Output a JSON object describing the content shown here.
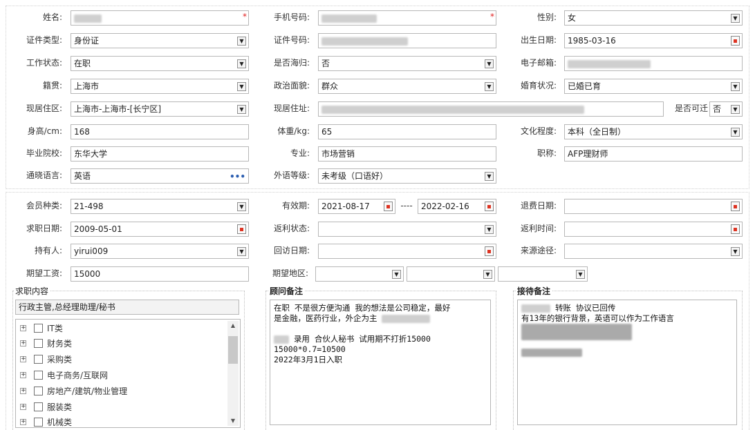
{
  "profile": {
    "name": {
      "label": "姓名:"
    },
    "mobile": {
      "label": "手机号码:"
    },
    "gender": {
      "label": "性别:",
      "value": "女"
    },
    "id_type": {
      "label": "证件类型:",
      "value": "身份证"
    },
    "id_number": {
      "label": "证件号码:"
    },
    "birth_date": {
      "label": "出生日期:",
      "value": "1985-03-16"
    },
    "work_status": {
      "label": "工作状态:",
      "value": "在职"
    },
    "returnee": {
      "label": "是否海归:",
      "value": "否"
    },
    "email": {
      "label": "电子邮箱:"
    },
    "native_place": {
      "label": "籍贯:",
      "value": "上海市"
    },
    "political": {
      "label": "政治面貌:",
      "value": "群众"
    },
    "marital": {
      "label": "婚育状况:",
      "value": "已婚已育"
    },
    "current_city": {
      "label": "现居住区:",
      "value": "上海市-上海市-[长宁区]"
    },
    "current_address": {
      "label": "现居住址:"
    },
    "relocate": {
      "label": "是否可迁",
      "value": "否"
    },
    "height": {
      "label": "身高/cm:",
      "value": "168"
    },
    "weight": {
      "label": "体重/kg:",
      "value": "65"
    },
    "education": {
      "label": "文化程度:",
      "value": "本科（全日制）"
    },
    "school": {
      "label": "毕业院校:",
      "value": "东华大学"
    },
    "major": {
      "label": "专业:",
      "value": "市场营销"
    },
    "title": {
      "label": "职称:",
      "value": "AFP理财师"
    },
    "language": {
      "label": "通晓语言:",
      "value": "英语"
    },
    "language_level": {
      "label": "外语等级:",
      "value": "未考级（口语好）"
    }
  },
  "membership": {
    "member_type": {
      "label": "会员种类:",
      "value": "21-498"
    },
    "validity": {
      "label": "有效期:",
      "start": "2021-08-17",
      "sep": "----",
      "end": "2022-02-16"
    },
    "refund_date": {
      "label": "退费日期:",
      "value": ""
    },
    "job_date": {
      "label": "求职日期:",
      "value": "2009-05-01"
    },
    "rebate_status": {
      "label": "返利状态:",
      "value": ""
    },
    "rebate_time": {
      "label": "返利时间:",
      "value": ""
    },
    "holder": {
      "label": "持有人:",
      "value": "yirui009"
    },
    "revisit_date": {
      "label": "回访日期:",
      "value": ""
    },
    "source": {
      "label": "来源途径:",
      "value": ""
    },
    "expected_salary": {
      "label": "期望工资:",
      "value": "15000"
    },
    "expected_area": {
      "label": "期望地区:"
    }
  },
  "job_content": {
    "legend": "求职内容",
    "selected": "行政主管,总经理助理/秘书",
    "tree": [
      "IT类",
      "财务类",
      "采购类",
      "电子商务/互联网",
      "房地产/建筑/物业管理",
      "服装类",
      "机械类"
    ]
  },
  "consultant_notes": {
    "legend": "顾问备注",
    "line1": "在职 不是很方便沟通 我的想法是公司稳定，最好",
    "line2": "是金融，医药行业，外企为主",
    "line3": "录用 合伙人秘书 试用期不打折15000",
    "line4": "15000*0.7=10500",
    "line5": "2022年3月1日入职"
  },
  "reception_notes": {
    "legend": "接待备注",
    "line1": "转账 协议已回传",
    "line2": "有13年的银行背景，英语可以作为工作语言"
  },
  "icons": {
    "dropdown": "chevron-down-icon",
    "calendar": "calendar-icon",
    "more": "more-dots-icon"
  },
  "colors": {
    "required": "#e02020",
    "border": "#b7b7b7"
  }
}
